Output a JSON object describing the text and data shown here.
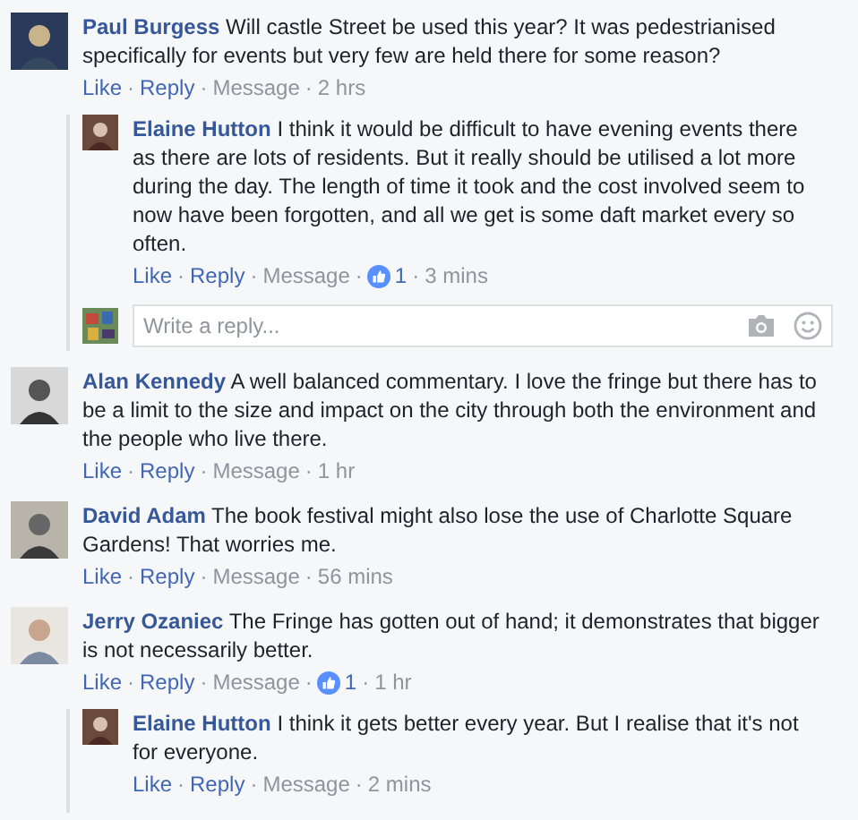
{
  "comments": [
    {
      "name": "Paul Burgess",
      "text": "Will castle Street be used this year? It was pedestrianised specifically for events but very few are held there for some reason?",
      "actions": [
        {
          "kind": "link",
          "text": "Like"
        },
        {
          "kind": "sep",
          "text": "·"
        },
        {
          "kind": "link",
          "text": "Reply"
        },
        {
          "kind": "sep",
          "text": "·"
        },
        {
          "kind": "message",
          "text": "Message"
        },
        {
          "kind": "sep",
          "text": "·"
        },
        {
          "kind": "time",
          "text": "2 hrs"
        }
      ],
      "replies": [
        {
          "name": "Elaine Hutton",
          "text": "I think it would be difficult to have evening events there as there are lots of residents. But it really should be utilised a lot more during the day. The length of time it took and the cost involved seem to now have been forgotten, and all we get is some daft market every so often.",
          "actions": [
            {
              "kind": "link",
              "text": "Like"
            },
            {
              "kind": "sep",
              "text": "·"
            },
            {
              "kind": "link",
              "text": "Reply"
            },
            {
              "kind": "sep",
              "text": "·"
            },
            {
              "kind": "message",
              "text": "Message"
            },
            {
              "kind": "sep",
              "text": "·"
            },
            {
              "kind": "likes",
              "text": "1"
            },
            {
              "kind": "sep",
              "text": "·"
            },
            {
              "kind": "time",
              "text": "3 mins"
            }
          ]
        }
      ],
      "reply_box": {
        "placeholder": "Write a reply..."
      }
    },
    {
      "name": "Alan Kennedy",
      "text": "A well balanced commentary. I love the fringe but there has to be a limit to the size and impact on the city through both the environment and the people who live there.",
      "actions": [
        {
          "kind": "link",
          "text": "Like"
        },
        {
          "kind": "sep",
          "text": "·"
        },
        {
          "kind": "link",
          "text": "Reply"
        },
        {
          "kind": "sep",
          "text": "·"
        },
        {
          "kind": "message",
          "text": "Message"
        },
        {
          "kind": "sep",
          "text": "·"
        },
        {
          "kind": "time",
          "text": "1 hr"
        }
      ]
    },
    {
      "name": "David Adam",
      "text": "The book festival might also lose the use of Charlotte Square Gardens! That worries me.",
      "actions": [
        {
          "kind": "link",
          "text": "Like"
        },
        {
          "kind": "sep",
          "text": "·"
        },
        {
          "kind": "link",
          "text": "Reply"
        },
        {
          "kind": "sep",
          "text": "·"
        },
        {
          "kind": "message",
          "text": "Message"
        },
        {
          "kind": "sep",
          "text": "·"
        },
        {
          "kind": "time",
          "text": "56 mins"
        }
      ]
    },
    {
      "name": "Jerry Ozaniec",
      "text": "The Fringe has gotten out of hand; it demonstrates that bigger is not necessarily better.",
      "actions": [
        {
          "kind": "link",
          "text": "Like"
        },
        {
          "kind": "sep",
          "text": "·"
        },
        {
          "kind": "link",
          "text": "Reply"
        },
        {
          "kind": "sep",
          "text": "·"
        },
        {
          "kind": "message",
          "text": "Message"
        },
        {
          "kind": "sep",
          "text": "·"
        },
        {
          "kind": "likes",
          "text": "1"
        },
        {
          "kind": "sep",
          "text": "·"
        },
        {
          "kind": "time",
          "text": "1 hr"
        }
      ],
      "replies": [
        {
          "name": "Elaine Hutton",
          "text": "I think it gets better every year. But I realise that it's not for everyone.",
          "actions": [
            {
              "kind": "link",
              "text": "Like"
            },
            {
              "kind": "sep",
              "text": "·"
            },
            {
              "kind": "link",
              "text": "Reply"
            },
            {
              "kind": "sep",
              "text": "·"
            },
            {
              "kind": "message",
              "text": "Message"
            },
            {
              "kind": "sep",
              "text": "·"
            },
            {
              "kind": "time",
              "text": "2 mins"
            }
          ]
        }
      ]
    }
  ]
}
